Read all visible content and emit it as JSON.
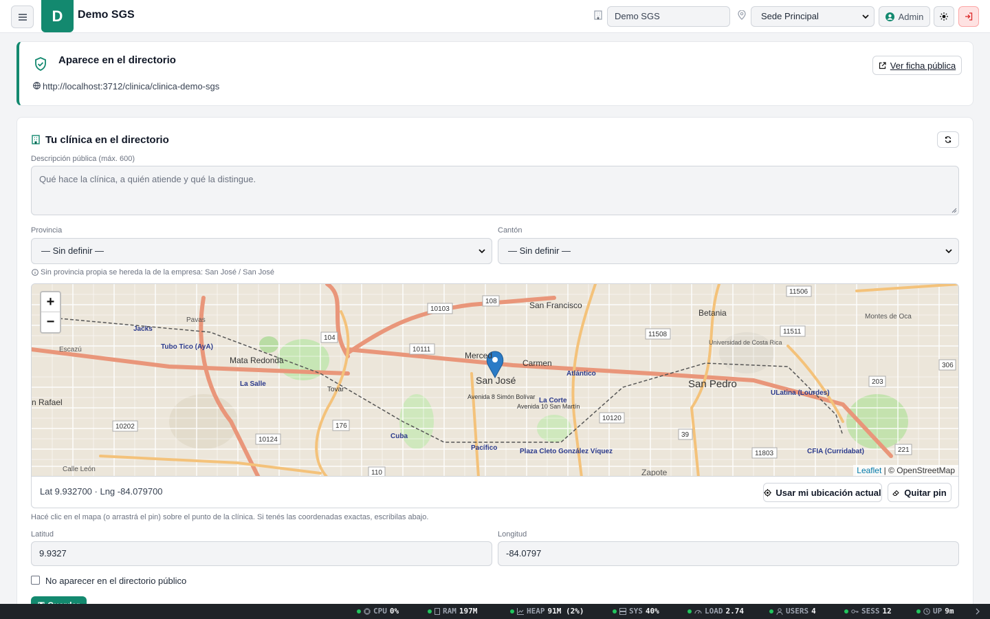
{
  "header": {
    "logo_letter": "D",
    "brand": "Demo SGS",
    "company_value": "Demo SGS",
    "sede_selected": "Sede Principal",
    "user_label": "Admin"
  },
  "directory_card": {
    "title": "Aparece en el directorio",
    "url": "http://localhost:3712/clinica/clinica-demo-sgs",
    "public_button": "Ver ficha pública"
  },
  "clinic_card": {
    "title": "Tu clínica en el directorio",
    "description_label": "Descripción pública (máx. 600)",
    "description_placeholder": "Qué hace la clínica, a quién atiende y qué la distingue.",
    "provincia_label": "Provincia",
    "provincia_value": "— Sin definir —",
    "canton_label": "Cantón",
    "canton_value": "— Sin definir —",
    "inherit_hint": "Sin provincia propia se hereda la de la empresa: San José / San José",
    "map": {
      "zoom_in": "+",
      "zoom_out": "−",
      "attribution_leaflet": "Leaflet",
      "attribution_osm": "| © OpenStreetMap",
      "labels": {
        "san_jose": "San José",
        "san_pedro": "San Pedro",
        "san_francisco": "San Francisco",
        "carmen": "Carmen",
        "merced": "Merced",
        "mata_redonda": "Mata Redonda",
        "betania": "Betania",
        "la_salle": "La Salle",
        "pavas": "Pavas",
        "jacks": "Jacks",
        "tovar": "Tovar",
        "atlantico": "Atlántico",
        "pacifico": "Pacífico",
        "la_corte": "La Corte",
        "cuba": "Cuba",
        "plaza_cleto": "Plaza Cleto González Víquez",
        "zapote": "Zapote",
        "ulatina": "ULatina (Lourdes)",
        "cfia": "CFIA (Curridabat)",
        "ucr": "Universidad de Costa Rica",
        "montes_oca": "Montes de Oca",
        "tubo_tico": "Tubo Tico (AyA)",
        "rafael": "n Rafael",
        "escazu": "Escazú",
        "calle_leon": "Calle León",
        "av_8": "Avenida 8 Simón Bolívar",
        "av_10": "Avenida 10 San Martín",
        "r_10103": "10103",
        "r_108": "108",
        "r_104": "104",
        "r_10111": "10111",
        "r_176": "176",
        "r_10124": "10124",
        "r_10202": "10202",
        "r_110": "110",
        "r_10120": "10120",
        "r_39": "39",
        "r_11803": "11803",
        "r_221": "221",
        "r_203": "203",
        "r_306": "306",
        "r_11511": "11511",
        "r_11506": "11506",
        "r_11508": "11508"
      }
    },
    "coords_text": "Lat 9.932700 · Lng -84.079700",
    "use_location_button": "Usar mi ubicación actual",
    "remove_pin_button": "Quitar pin",
    "map_hint": "Hacé clic en el mapa (o arrastrá el pin) sobre el punto de la clínica. Si tenés las coordenadas exactas, escribilas abajo.",
    "lat_label": "Latitud",
    "lat_value": "9.9327",
    "lng_label": "Longitud",
    "lng_value": "-84.0797",
    "hide_checkbox_label": "No aparecer en el directorio público",
    "save_button": "Guardar"
  },
  "statusbar": [
    {
      "key": "CPU",
      "value": "0%"
    },
    {
      "key": "RAM",
      "value": "197M"
    },
    {
      "key": "HEAP",
      "value": "91M (2%)"
    },
    {
      "key": "SYS",
      "value": "40%"
    },
    {
      "key": "LOAD",
      "value": "2.74"
    },
    {
      "key": "USERS",
      "value": "4"
    },
    {
      "key": "SESS",
      "value": "12"
    },
    {
      "key": "UP",
      "value": "9m"
    }
  ],
  "colors": {
    "accent": "#13896f",
    "statusbar_bg": "#1f2328",
    "status_ok": "#22c55e"
  }
}
